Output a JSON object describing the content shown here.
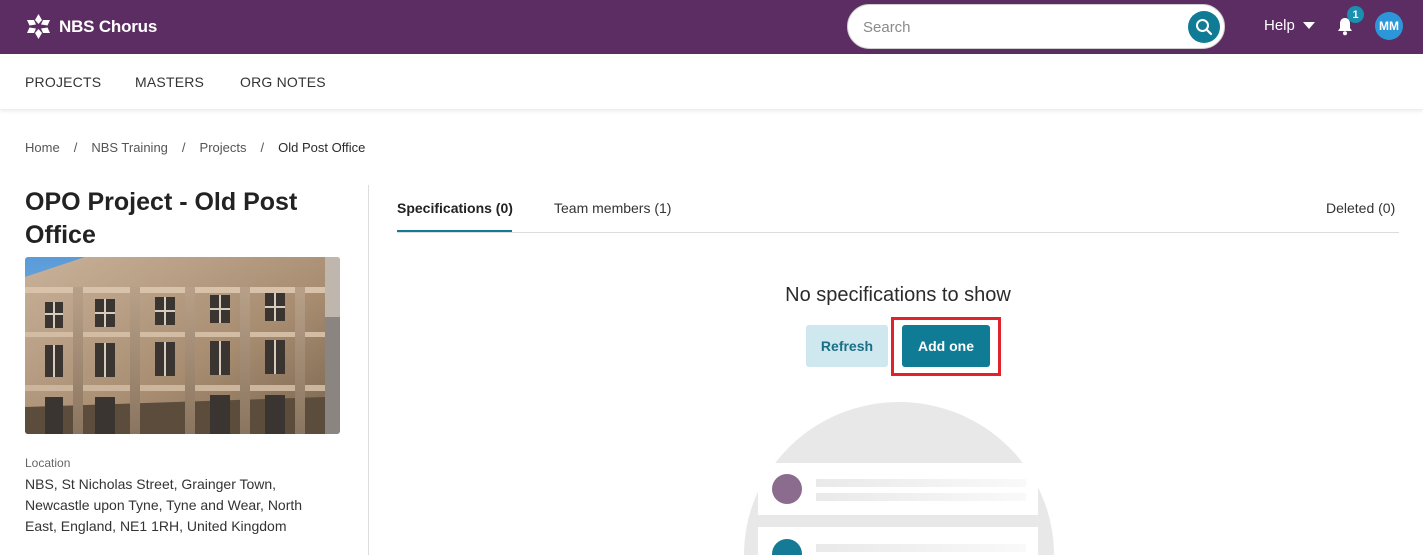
{
  "app": {
    "name": "NBS Chorus"
  },
  "search": {
    "placeholder": "Search"
  },
  "header": {
    "help_label": "Help",
    "notification_count": "1",
    "avatar_initials": "MM"
  },
  "nav": {
    "items": [
      {
        "label": "PROJECTS"
      },
      {
        "label": "MASTERS"
      },
      {
        "label": "ORG NOTES"
      }
    ]
  },
  "breadcrumb": {
    "items": [
      {
        "label": "Home"
      },
      {
        "label": "NBS Training"
      },
      {
        "label": "Projects"
      },
      {
        "label": "Old Post Office"
      }
    ],
    "separator": "/"
  },
  "project": {
    "title": "OPO Project - Old Post Office",
    "location_label": "Location",
    "location": "NBS, St Nicholas Street, Grainger Town, Newcastle upon Tyne, Tyne and Wear, North East, England, NE1 1RH, United Kingdom"
  },
  "tabs": [
    {
      "label": "Specifications (0)",
      "active": true
    },
    {
      "label": "Team members (1)",
      "active": false
    }
  ],
  "deleted_tab": {
    "label": "Deleted (0)"
  },
  "empty_state": {
    "title": "No specifications to show",
    "refresh_label": "Refresh",
    "add_label": "Add one"
  },
  "colors": {
    "brand": "#5c2d62",
    "accent": "#0f7b95",
    "highlight": "#e2222a",
    "avatar": "#2d96d8"
  }
}
